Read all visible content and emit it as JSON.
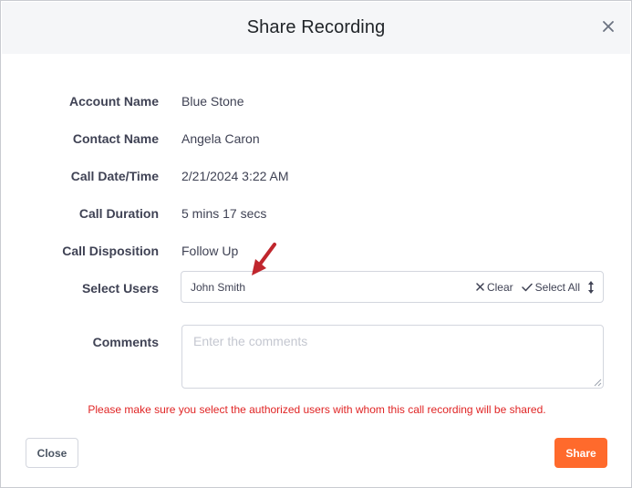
{
  "dialog": {
    "title": "Share Recording"
  },
  "fields": [
    {
      "label": "Account Name",
      "value": "Blue Stone"
    },
    {
      "label": "Contact Name",
      "value": "Angela Caron"
    },
    {
      "label": "Call Date/Time",
      "value": "2/21/2024 3:22 AM"
    },
    {
      "label": "Call Duration",
      "value": "5 mins 17 secs"
    },
    {
      "label": "Call Disposition",
      "value": "Follow Up"
    }
  ],
  "select_users": {
    "label": "Select Users",
    "selected": "John Smith",
    "clear_label": "Clear",
    "select_all_label": "Select All"
  },
  "comments": {
    "label": "Comments",
    "placeholder": "Enter the comments",
    "value": ""
  },
  "warning": "Please make sure you select the authorized users with whom this call recording will be shared.",
  "buttons": {
    "close_label": "Close",
    "share_label": "Share"
  },
  "colors": {
    "accent": "#ff6a2c",
    "warning": "#e02424",
    "annotation_arrow": "#c0262d"
  },
  "icons": {
    "close": "close-icon",
    "clear": "x-icon",
    "select_all": "check-icon",
    "sort": "sort-arrows-icon",
    "annotation": "arrow-pointer-icon"
  }
}
